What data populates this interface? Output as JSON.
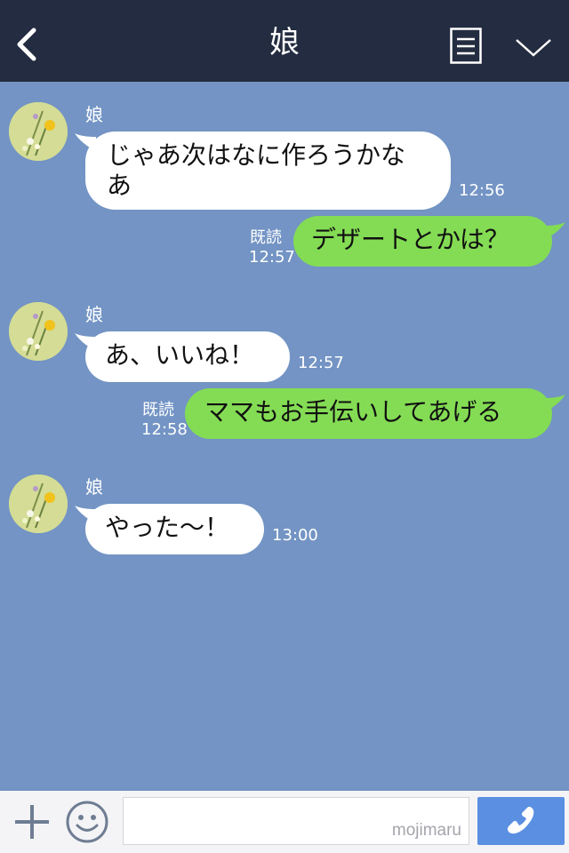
{
  "header": {
    "title": "娘"
  },
  "messages": [
    {
      "type": "in",
      "sender": "娘",
      "lines": [
        "じゃあ次はなに作ろうかな",
        "あ"
      ],
      "time": "12:56"
    },
    {
      "type": "out",
      "text": "デザートとかは？",
      "read": "既読",
      "time": "12:57"
    },
    {
      "type": "in",
      "sender": "娘",
      "lines": [
        "あ、いいね！"
      ],
      "time": "12:57"
    },
    {
      "type": "out",
      "text": "ママもお手伝いしてあげる",
      "read": "既読",
      "time": "12:58"
    },
    {
      "type": "in",
      "sender": "娘",
      "lines": [
        "やった〜！"
      ],
      "time": "13:00"
    }
  ],
  "footer": {
    "watermark": "mojimaru"
  },
  "colors": {
    "header_bg": "#232c40",
    "chat_bg": "#7394c4",
    "incoming_bubble": "#ffffff",
    "outgoing_bubble": "#84dc54",
    "call_button": "#5a8fe2"
  },
  "icons": [
    "back-icon",
    "menu-icon",
    "chevron-down-icon",
    "plus-icon",
    "smile-icon",
    "phone-icon"
  ]
}
